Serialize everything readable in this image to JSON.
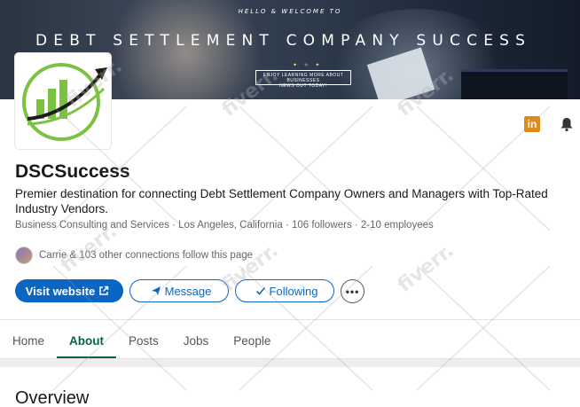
{
  "banner": {
    "welcome": "HELLO & WELCOME TO",
    "headline": "DEBT SETTLEMENT COMPANY SUCCESS",
    "cta_line1": "ENJOY LEARNING MORE ABOUT BUSINESSES",
    "cta_line2": "NEWS OUT TODAY!"
  },
  "company": {
    "name": "DSCSuccess",
    "tagline": "Premier destination for connecting Debt Settlement Company Owners and Managers with Top-Rated Industry Vendors.",
    "meta": "Business Consulting and Services · Los Angeles, California · 106 followers · 2-10 employees",
    "connections": "Carrie & 103 other connections follow this page"
  },
  "icons": {
    "linkedin": "in",
    "bell": "bell-icon"
  },
  "actions": {
    "visit_label": "Visit website",
    "message_label": "Message",
    "following_label": "Following",
    "more_label": "•••"
  },
  "tabs": [
    "Home",
    "About",
    "Posts",
    "Jobs",
    "People"
  ],
  "active_tab": "About",
  "section": {
    "title": "Overview"
  },
  "watermark": "fiverr.",
  "colors": {
    "accent": "#0a66c2",
    "tab_active": "#056547",
    "logo_green": "#7cc242"
  }
}
